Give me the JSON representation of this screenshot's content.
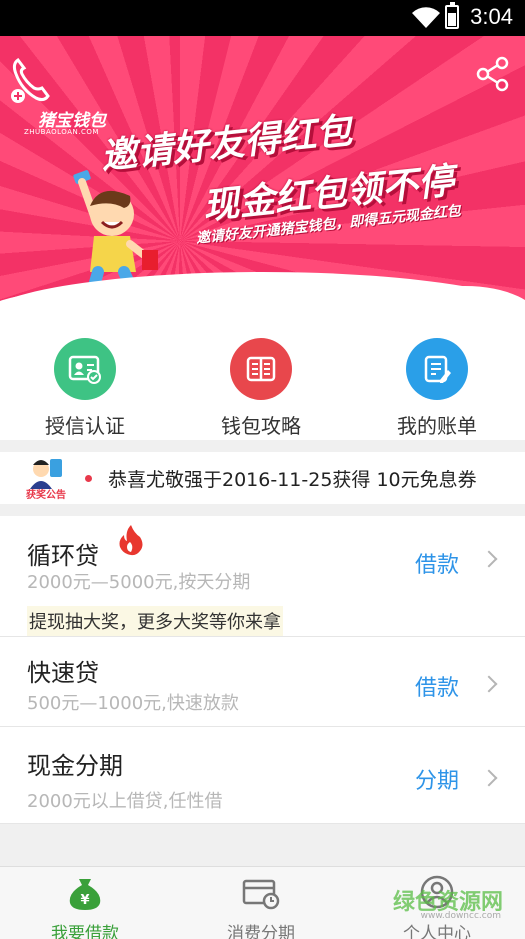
{
  "status_bar": {
    "time": "3:04"
  },
  "banner": {
    "logo_title": "猪宝钱包",
    "logo_sub": "ZHUBAOLOAN.COM",
    "headline_1": "邀请好友得红包",
    "headline_2": "现金红包领不停",
    "headline_3": "邀请好友开通猪宝钱包，即得五元现金红包",
    "icons": [
      "phone-icon",
      "share-icon"
    ],
    "colors": {
      "bg": "#f33266",
      "stripe": "#ff4a78"
    }
  },
  "quick_actions": [
    {
      "label": "授信认证",
      "icon": "id-card-icon",
      "color": "#3ec384"
    },
    {
      "label": "钱包攻略",
      "icon": "book-icon",
      "color": "#e8474c"
    },
    {
      "label": "我的账单",
      "icon": "bill-icon",
      "color": "#2a9fe8"
    }
  ],
  "notice": {
    "badge": "获奖公告",
    "text": "恭喜尤敬强于2016-11-25获得 10元免息券"
  },
  "products": [
    {
      "name": "循环贷",
      "desc": "2000元—5000元,按天分期",
      "action": "借款",
      "promo": "提现抽大奖，更多大奖等你来拿",
      "icon": "fire-icon"
    },
    {
      "name": "快速贷",
      "desc": "500元—1000元,快速放款",
      "action": "借款"
    },
    {
      "name": "现金分期",
      "desc": "2000元以上借贷,任性借",
      "action": "分期"
    }
  ],
  "tabs": [
    {
      "label": "我要借款",
      "icon": "money-bag-icon",
      "active": true
    },
    {
      "label": "消费分期",
      "icon": "card-icon",
      "active": false
    },
    {
      "label": "个人中心",
      "icon": "user-icon",
      "active": false
    }
  ],
  "watermark": {
    "main": "绿色资源网",
    "sub": "www.downcc.com"
  },
  "accent": {
    "green": "#3aa03a",
    "blue": "#2e94e8"
  }
}
